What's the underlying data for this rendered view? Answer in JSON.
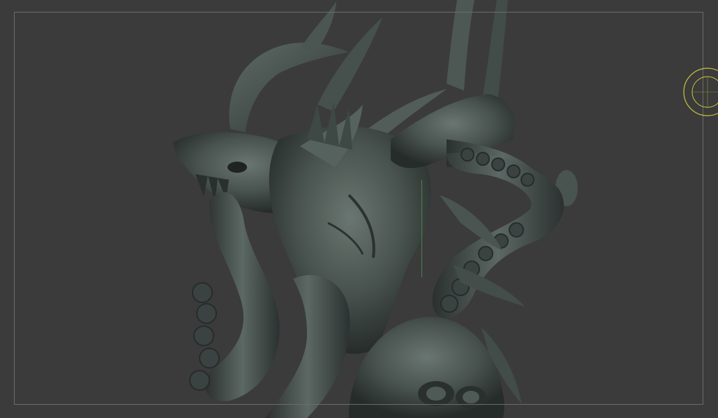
{
  "viewport": {
    "background_color": "#3b3b3b",
    "frame_color": "#6c6c6c",
    "axis_color": "#4f8f4f",
    "gizmo_color": "#c8c43a",
    "mesh_color": "#4a5450"
  },
  "icons": {
    "gizmo": "navigation-gizmo-icon"
  }
}
